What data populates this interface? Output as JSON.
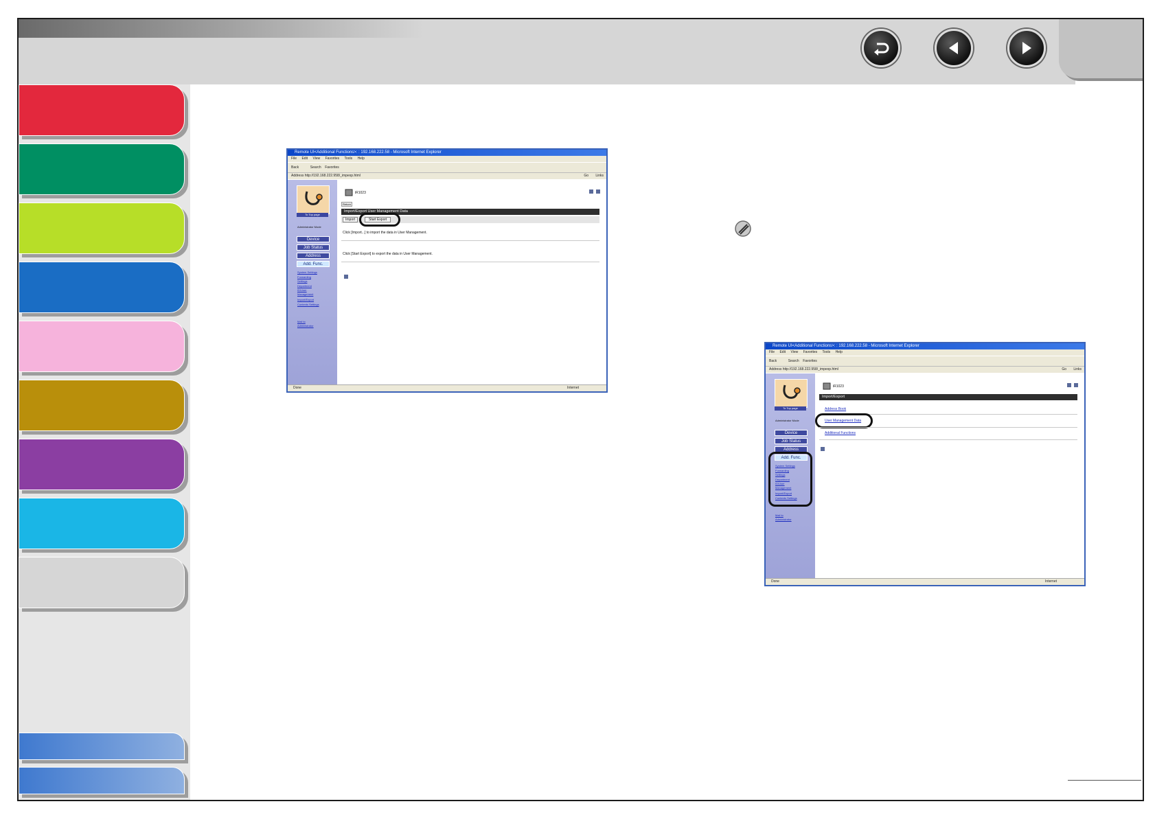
{
  "navigation": {
    "back_icon": "return-arrow-icon",
    "prev_icon": "left-triangle-icon",
    "next_icon": "right-triangle-icon"
  },
  "chapter_tab_colors": [
    "#e3283d",
    "#008f62",
    "#b7de28",
    "#1a6dc4",
    "#f6b3dc",
    "#b98f0b",
    "#8b3ea2",
    "#1ab6e6",
    "#d6d6d6"
  ],
  "note_icon": "pencil-note-icon",
  "screenshot_1": {
    "window_title": "Remote UI<Additional Functions>: : 192.168.222.58 - Microsoft Internet Explorer",
    "menu": [
      "File",
      "Edit",
      "View",
      "Favorites",
      "Tools",
      "Help"
    ],
    "toolbar": [
      "Back",
      "Search",
      "Favorites"
    ],
    "address_label": "Address",
    "address_url": "http://192.168.222.958/_impexp.html",
    "go_label": "Go",
    "links_label": "Links",
    "logo_caption": "To Top page",
    "mode_label": "Administrator Mode",
    "left_buttons": [
      "Device",
      "Job Status",
      "Address",
      "Add. Func."
    ],
    "left_links": [
      "System Settings",
      "Forwarding Settings",
      "Department ID/User Management",
      "Import/Export",
      "Contents Settings"
    ],
    "macro_link": "Mail to Administrator",
    "device_name": "iR1023",
    "back_tag": "Return",
    "section_header": "Import/Export User Management Data",
    "import_button": "Import",
    "export_button": "Start Export",
    "import_text": "Click [Import...] to import the data in User Management.",
    "export_text": "Click [Start Export] to export the data in User Management.",
    "status_left": "Done",
    "status_right": "Internet"
  },
  "screenshot_2": {
    "window_title": "Remote UI<Additional Functions>: : 192.168.222.58 - Microsoft Internet Explorer",
    "menu": [
      "File",
      "Edit",
      "View",
      "Favorites",
      "Tools",
      "Help"
    ],
    "toolbar": [
      "Back",
      "Search",
      "Favorites"
    ],
    "address_label": "Address",
    "address_url": "http://192.168.222.958/_impexp.html",
    "go_label": "Go",
    "links_label": "Links",
    "logo_caption": "To Top page",
    "mode_label": "Administrator Mode",
    "left_buttons": [
      "Device",
      "Job Status",
      "Address",
      "Add. Func."
    ],
    "left_links": [
      "System Settings",
      "Forwarding Settings",
      "Department ID/User Management",
      "Import/Export",
      "Contents Settings"
    ],
    "macro_link": "Mail to Administrator",
    "device_name": "iR1023",
    "section_header": "Import/Export",
    "items": [
      "Address Book",
      "User Management Data",
      "Additional Functions"
    ],
    "status_left": "Done",
    "status_right": "Internet"
  }
}
